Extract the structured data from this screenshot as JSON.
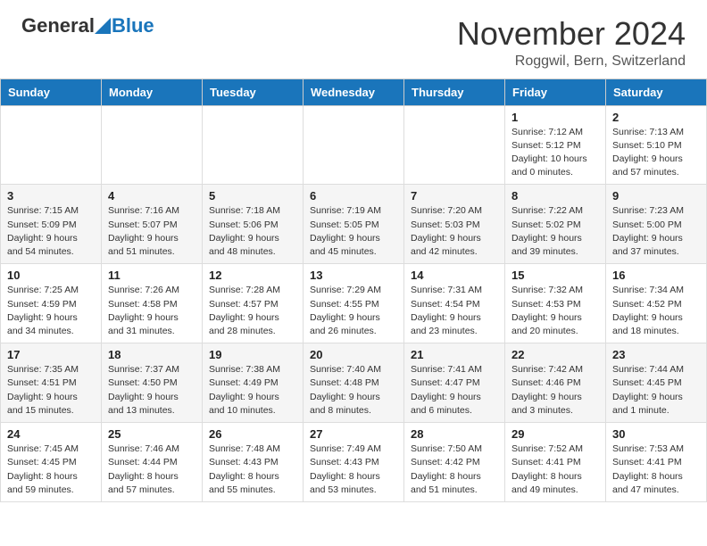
{
  "header": {
    "logo_general": "General",
    "logo_blue": "Blue",
    "title": "November 2024",
    "location": "Roggwil, Bern, Switzerland"
  },
  "weekdays": [
    "Sunday",
    "Monday",
    "Tuesday",
    "Wednesday",
    "Thursday",
    "Friday",
    "Saturday"
  ],
  "weeks": [
    [
      {
        "day": "",
        "info": ""
      },
      {
        "day": "",
        "info": ""
      },
      {
        "day": "",
        "info": ""
      },
      {
        "day": "",
        "info": ""
      },
      {
        "day": "",
        "info": ""
      },
      {
        "day": "1",
        "info": "Sunrise: 7:12 AM\nSunset: 5:12 PM\nDaylight: 10 hours\nand 0 minutes."
      },
      {
        "day": "2",
        "info": "Sunrise: 7:13 AM\nSunset: 5:10 PM\nDaylight: 9 hours\nand 57 minutes."
      }
    ],
    [
      {
        "day": "3",
        "info": "Sunrise: 7:15 AM\nSunset: 5:09 PM\nDaylight: 9 hours\nand 54 minutes."
      },
      {
        "day": "4",
        "info": "Sunrise: 7:16 AM\nSunset: 5:07 PM\nDaylight: 9 hours\nand 51 minutes."
      },
      {
        "day": "5",
        "info": "Sunrise: 7:18 AM\nSunset: 5:06 PM\nDaylight: 9 hours\nand 48 minutes."
      },
      {
        "day": "6",
        "info": "Sunrise: 7:19 AM\nSunset: 5:05 PM\nDaylight: 9 hours\nand 45 minutes."
      },
      {
        "day": "7",
        "info": "Sunrise: 7:20 AM\nSunset: 5:03 PM\nDaylight: 9 hours\nand 42 minutes."
      },
      {
        "day": "8",
        "info": "Sunrise: 7:22 AM\nSunset: 5:02 PM\nDaylight: 9 hours\nand 39 minutes."
      },
      {
        "day": "9",
        "info": "Sunrise: 7:23 AM\nSunset: 5:00 PM\nDaylight: 9 hours\nand 37 minutes."
      }
    ],
    [
      {
        "day": "10",
        "info": "Sunrise: 7:25 AM\nSunset: 4:59 PM\nDaylight: 9 hours\nand 34 minutes."
      },
      {
        "day": "11",
        "info": "Sunrise: 7:26 AM\nSunset: 4:58 PM\nDaylight: 9 hours\nand 31 minutes."
      },
      {
        "day": "12",
        "info": "Sunrise: 7:28 AM\nSunset: 4:57 PM\nDaylight: 9 hours\nand 28 minutes."
      },
      {
        "day": "13",
        "info": "Sunrise: 7:29 AM\nSunset: 4:55 PM\nDaylight: 9 hours\nand 26 minutes."
      },
      {
        "day": "14",
        "info": "Sunrise: 7:31 AM\nSunset: 4:54 PM\nDaylight: 9 hours\nand 23 minutes."
      },
      {
        "day": "15",
        "info": "Sunrise: 7:32 AM\nSunset: 4:53 PM\nDaylight: 9 hours\nand 20 minutes."
      },
      {
        "day": "16",
        "info": "Sunrise: 7:34 AM\nSunset: 4:52 PM\nDaylight: 9 hours\nand 18 minutes."
      }
    ],
    [
      {
        "day": "17",
        "info": "Sunrise: 7:35 AM\nSunset: 4:51 PM\nDaylight: 9 hours\nand 15 minutes."
      },
      {
        "day": "18",
        "info": "Sunrise: 7:37 AM\nSunset: 4:50 PM\nDaylight: 9 hours\nand 13 minutes."
      },
      {
        "day": "19",
        "info": "Sunrise: 7:38 AM\nSunset: 4:49 PM\nDaylight: 9 hours\nand 10 minutes."
      },
      {
        "day": "20",
        "info": "Sunrise: 7:40 AM\nSunset: 4:48 PM\nDaylight: 9 hours\nand 8 minutes."
      },
      {
        "day": "21",
        "info": "Sunrise: 7:41 AM\nSunset: 4:47 PM\nDaylight: 9 hours\nand 6 minutes."
      },
      {
        "day": "22",
        "info": "Sunrise: 7:42 AM\nSunset: 4:46 PM\nDaylight: 9 hours\nand 3 minutes."
      },
      {
        "day": "23",
        "info": "Sunrise: 7:44 AM\nSunset: 4:45 PM\nDaylight: 9 hours\nand 1 minute."
      }
    ],
    [
      {
        "day": "24",
        "info": "Sunrise: 7:45 AM\nSunset: 4:45 PM\nDaylight: 8 hours\nand 59 minutes."
      },
      {
        "day": "25",
        "info": "Sunrise: 7:46 AM\nSunset: 4:44 PM\nDaylight: 8 hours\nand 57 minutes."
      },
      {
        "day": "26",
        "info": "Sunrise: 7:48 AM\nSunset: 4:43 PM\nDaylight: 8 hours\nand 55 minutes."
      },
      {
        "day": "27",
        "info": "Sunrise: 7:49 AM\nSunset: 4:43 PM\nDaylight: 8 hours\nand 53 minutes."
      },
      {
        "day": "28",
        "info": "Sunrise: 7:50 AM\nSunset: 4:42 PM\nDaylight: 8 hours\nand 51 minutes."
      },
      {
        "day": "29",
        "info": "Sunrise: 7:52 AM\nSunset: 4:41 PM\nDaylight: 8 hours\nand 49 minutes."
      },
      {
        "day": "30",
        "info": "Sunrise: 7:53 AM\nSunset: 4:41 PM\nDaylight: 8 hours\nand 47 minutes."
      }
    ]
  ]
}
